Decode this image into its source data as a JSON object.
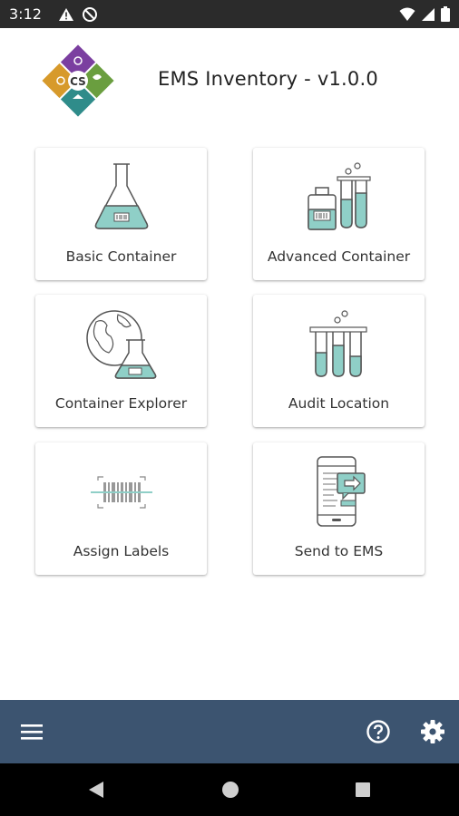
{
  "status_bar": {
    "time": "3:12",
    "icons": [
      "warning-icon",
      "sync-disabled-icon",
      "wifi-icon",
      "signal-icon",
      "battery-icon"
    ]
  },
  "header": {
    "title": "EMS Inventory - v1.0.0",
    "logo_text": "CS"
  },
  "cards": [
    {
      "label": "Basic Container",
      "icon": "flask-icon"
    },
    {
      "label": "Advanced Container",
      "icon": "flask-tubes-icon"
    },
    {
      "label": "Container Explorer",
      "icon": "globe-flask-icon"
    },
    {
      "label": "Audit Location",
      "icon": "test-tubes-icon"
    },
    {
      "label": "Assign Labels",
      "icon": "barcode-scan-icon"
    },
    {
      "label": "Send to EMS",
      "icon": "phone-send-icon"
    }
  ],
  "bottom_bar": {
    "icons": [
      "menu-icon",
      "help-icon",
      "settings-icon"
    ]
  },
  "colors": {
    "accent_teal": "#8fcfc7",
    "line": "#555555",
    "bottom_bar": "#3c5470",
    "status_bar": "#2b2b2b"
  }
}
